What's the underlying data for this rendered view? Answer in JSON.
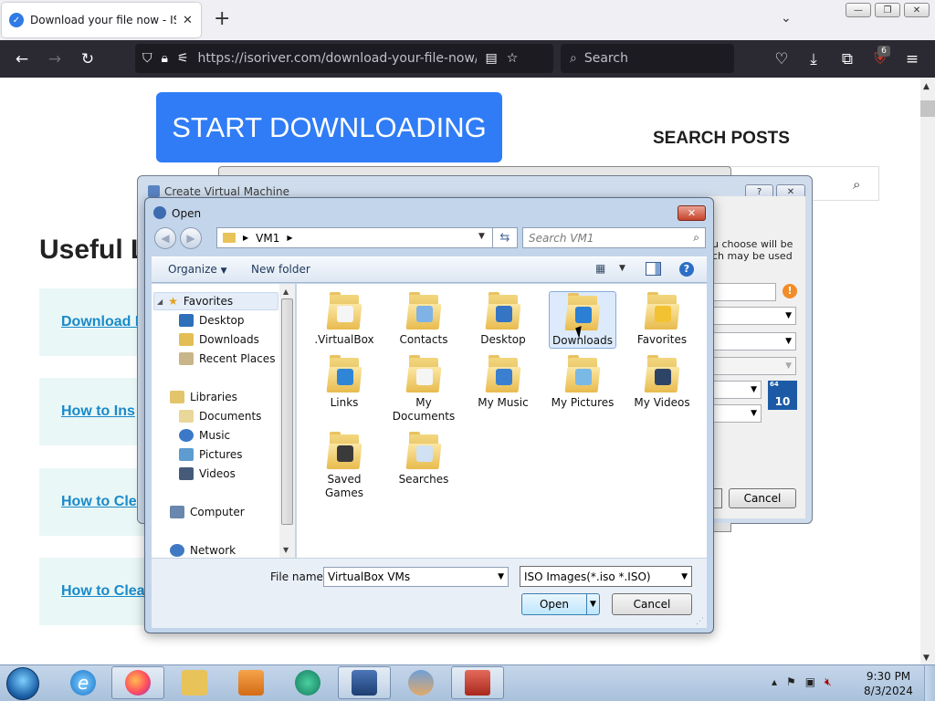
{
  "browser": {
    "tab_title": "Download your file now - ISORIVER",
    "url": "https://isoriver.com/download-your-file-now/?url=",
    "search_placeholder": "Search",
    "extension_badge": "6"
  },
  "page": {
    "start_button": "START DOWNLOADING",
    "search_posts_heading": "SEARCH POSTS",
    "useful_heading": "Useful L",
    "posts": [
      "Download I",
      "How to Ins",
      "How to Cle",
      "How to Clea"
    ]
  },
  "create_vm_dialog": {
    "title": "Create Virtual Machine",
    "help_label": "?",
    "description": "u choose will be\nch may be used",
    "os_badge_top": "64",
    "os_badge_bottom": "10",
    "cancel": "Cancel"
  },
  "open_dialog": {
    "title": "Open",
    "path": [
      "VM1"
    ],
    "search_placeholder": "Search VM1",
    "toolbar": {
      "organize": "Organize",
      "new_folder": "New folder"
    },
    "nav": {
      "favorites": "Favorites",
      "favorites_items": [
        "Desktop",
        "Downloads",
        "Recent Places"
      ],
      "libraries": "Libraries",
      "libraries_items": [
        "Documents",
        "Music",
        "Pictures",
        "Videos"
      ],
      "computer": "Computer",
      "network": "Network"
    },
    "items": [
      {
        "label": ".VirtualBox",
        "emblem": "document-emblem"
      },
      {
        "label": "Contacts",
        "emblem": "contacts-emblem"
      },
      {
        "label": "Desktop",
        "emblem": "desktop-emblem"
      },
      {
        "label": "Downloads",
        "emblem": "download-arrow-emblem"
      },
      {
        "label": "Favorites",
        "emblem": "star-emblem"
      },
      {
        "label": "Links",
        "emblem": "link-arrow-emblem"
      },
      {
        "label": "My Documents",
        "emblem": "document-emblem"
      },
      {
        "label": "My Music",
        "emblem": "music-note-emblem"
      },
      {
        "label": "My Pictures",
        "emblem": "picture-emblem"
      },
      {
        "label": "My Videos",
        "emblem": "film-emblem"
      },
      {
        "label": "Saved Games",
        "emblem": "chess-piece-emblem"
      },
      {
        "label": "Searches",
        "emblem": "magnifier-emblem"
      }
    ],
    "selected_item": "Downloads",
    "file_name_label": "File name:",
    "file_name_value": "VirtualBox VMs",
    "file_type": "ISO Images(*.iso *.ISO)",
    "open_button": "Open",
    "cancel_button": "Cancel"
  },
  "taskbar": {
    "clock_time": "9:30 PM",
    "clock_date": "8/3/2024"
  },
  "colors": {
    "accent_blue": "#2f7cf6",
    "link_teal": "#1a8ac9",
    "card_bg": "#e9f7f6",
    "dialog_frame": "#c3d5ea"
  }
}
